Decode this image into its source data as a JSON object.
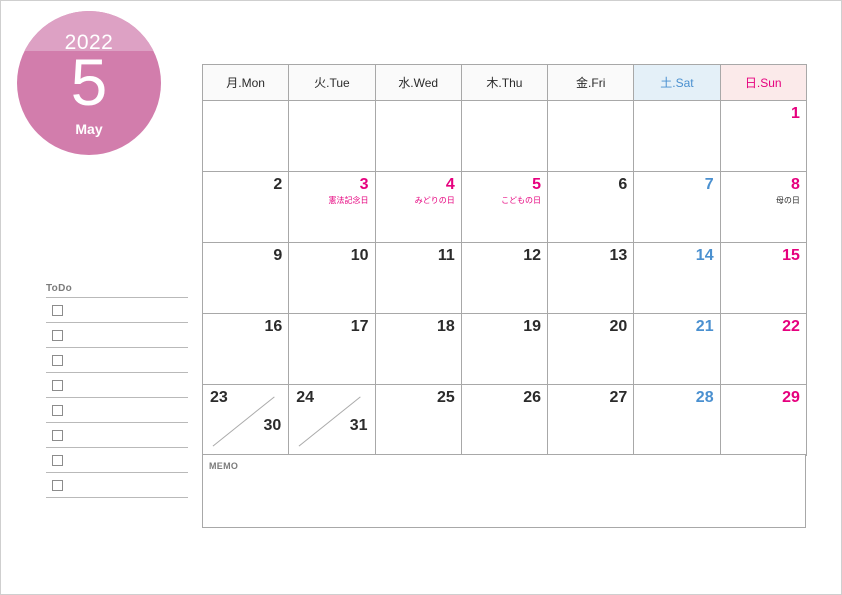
{
  "badge": {
    "year": "2022",
    "month_number": "5",
    "month_name": "May"
  },
  "colors": {
    "badge_top": "#ddA1c4",
    "badge_bottom": "#d27dac",
    "sunday_text": "#e6007e",
    "saturday_text": "#4a90d0",
    "sunday_header_bg": "#fbeaea",
    "saturday_header_bg": "#e4f0f8",
    "weekday_text": "#2b2b2b",
    "grid_line": "#a8a8a8"
  },
  "calendar": {
    "headers": [
      {
        "label": "月.Mon",
        "type": "weekday"
      },
      {
        "label": "火.Tue",
        "type": "weekday"
      },
      {
        "label": "水.Wed",
        "type": "weekday"
      },
      {
        "label": "木.Thu",
        "type": "weekday"
      },
      {
        "label": "金.Fri",
        "type": "weekday"
      },
      {
        "label": "土.Sat",
        "type": "saturday"
      },
      {
        "label": "日.Sun",
        "type": "sunday"
      }
    ],
    "weeks": [
      [
        {
          "day": "",
          "color": "dark",
          "holiday": "",
          "empty": true
        },
        {
          "day": "",
          "color": "dark",
          "holiday": "",
          "empty": true
        },
        {
          "day": "",
          "color": "dark",
          "holiday": "",
          "empty": true
        },
        {
          "day": "",
          "color": "dark",
          "holiday": "",
          "empty": true
        },
        {
          "day": "",
          "color": "dark",
          "holiday": "",
          "empty": true
        },
        {
          "day": "",
          "color": "dark",
          "holiday": "",
          "empty": true
        },
        {
          "day": "1",
          "color": "pink",
          "holiday": ""
        }
      ],
      [
        {
          "day": "2",
          "color": "dark",
          "holiday": ""
        },
        {
          "day": "3",
          "color": "pink",
          "holiday": "憲法記念日",
          "holiday_color": "pink"
        },
        {
          "day": "4",
          "color": "pink",
          "holiday": "みどりの日",
          "holiday_color": "pink"
        },
        {
          "day": "5",
          "color": "pink",
          "holiday": "こどもの日",
          "holiday_color": "pink"
        },
        {
          "day": "6",
          "color": "dark",
          "holiday": ""
        },
        {
          "day": "7",
          "color": "blue",
          "holiday": ""
        },
        {
          "day": "8",
          "color": "pink",
          "holiday": "母の日",
          "holiday_color": "dark"
        }
      ],
      [
        {
          "day": "9",
          "color": "dark",
          "holiday": ""
        },
        {
          "day": "10",
          "color": "dark",
          "holiday": ""
        },
        {
          "day": "11",
          "color": "dark",
          "holiday": ""
        },
        {
          "day": "12",
          "color": "dark",
          "holiday": ""
        },
        {
          "day": "13",
          "color": "dark",
          "holiday": ""
        },
        {
          "day": "14",
          "color": "blue",
          "holiday": ""
        },
        {
          "day": "15",
          "color": "pink",
          "holiday": ""
        }
      ],
      [
        {
          "day": "16",
          "color": "dark",
          "holiday": ""
        },
        {
          "day": "17",
          "color": "dark",
          "holiday": ""
        },
        {
          "day": "18",
          "color": "dark",
          "holiday": ""
        },
        {
          "day": "19",
          "color": "dark",
          "holiday": ""
        },
        {
          "day": "20",
          "color": "dark",
          "holiday": ""
        },
        {
          "day": "21",
          "color": "blue",
          "holiday": ""
        },
        {
          "day": "22",
          "color": "pink",
          "holiday": ""
        }
      ],
      [
        {
          "day": "23",
          "second_day": "30",
          "color": "dark",
          "split": true,
          "holiday": ""
        },
        {
          "day": "24",
          "second_day": "31",
          "color": "dark",
          "split": true,
          "holiday": ""
        },
        {
          "day": "25",
          "color": "dark",
          "holiday": ""
        },
        {
          "day": "26",
          "color": "dark",
          "holiday": ""
        },
        {
          "day": "27",
          "color": "dark",
          "holiday": ""
        },
        {
          "day": "28",
          "color": "blue",
          "holiday": ""
        },
        {
          "day": "29",
          "color": "pink",
          "holiday": ""
        }
      ]
    ]
  },
  "todo": {
    "title": "ToDo",
    "row_count": 8
  },
  "memo": {
    "title": "MEMO"
  }
}
